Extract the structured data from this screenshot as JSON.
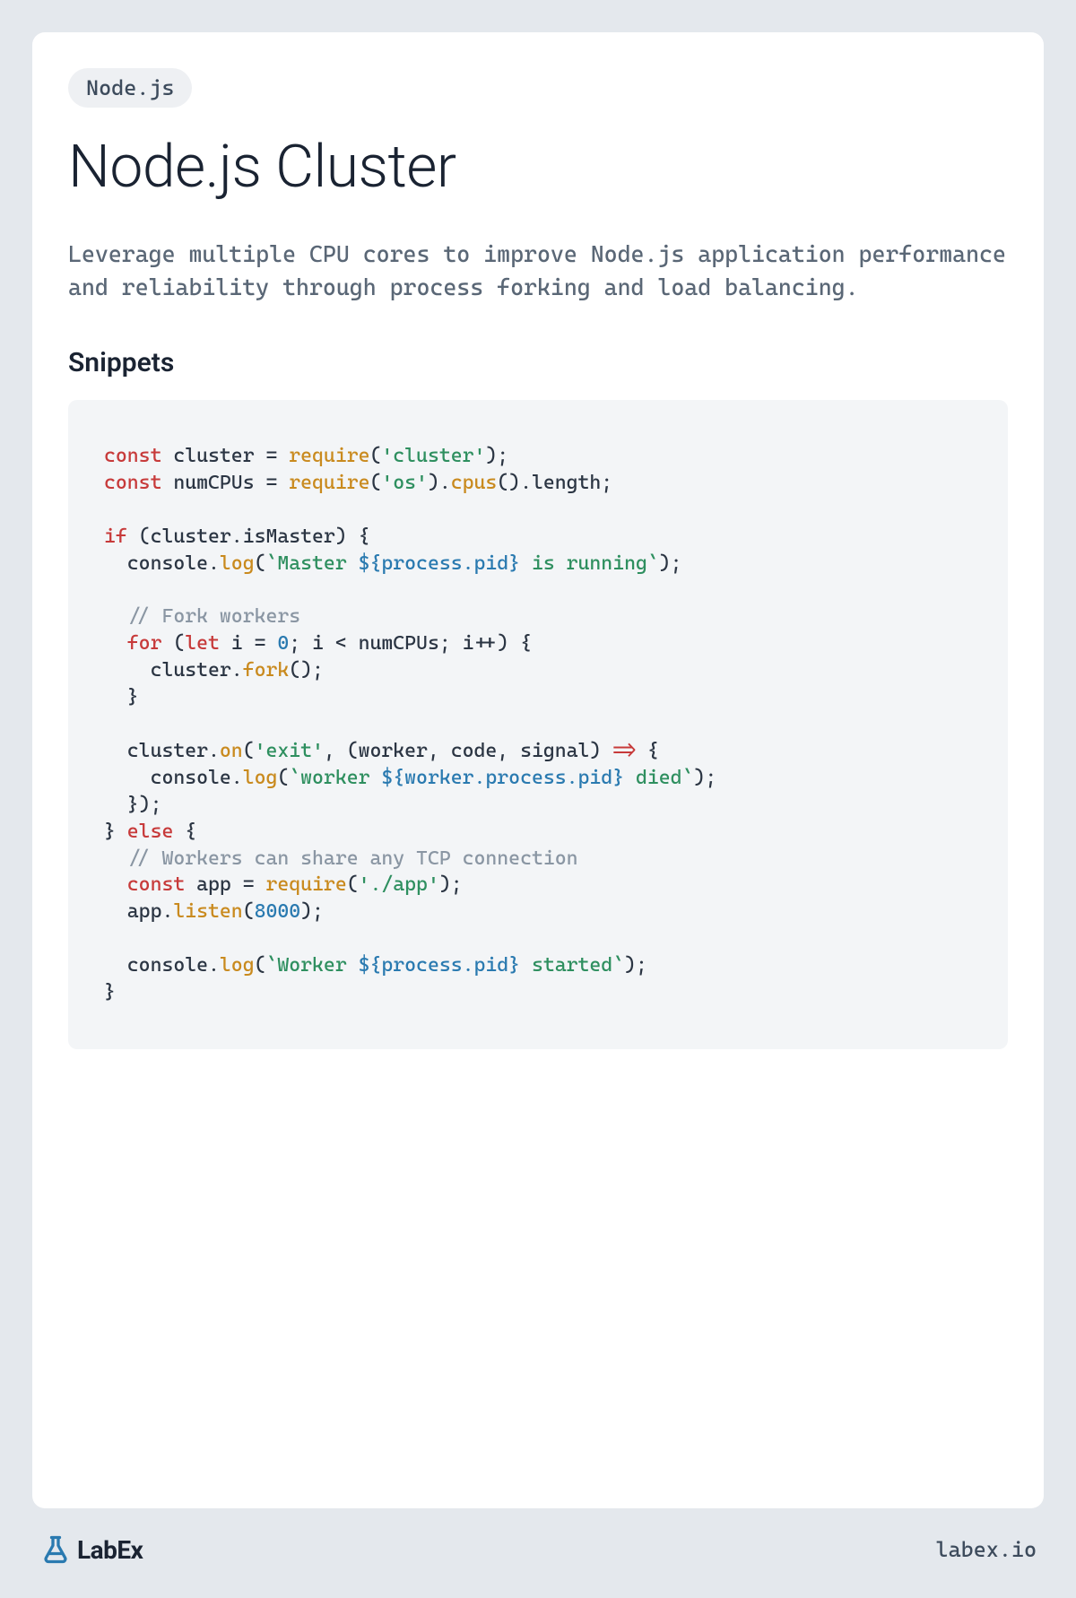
{
  "tag": "Node.js",
  "title": "Node.js Cluster",
  "description": "Leverage multiple CPU cores to improve Node.js application performance and reliability through process forking and load balancing.",
  "section_heading": "Snippets",
  "snippet": {
    "tokens": [
      {
        "t": "const",
        "c": "tok-kw"
      },
      {
        "t": " cluster = "
      },
      {
        "t": "require",
        "c": "tok-fn"
      },
      {
        "t": "("
      },
      {
        "t": "'cluster'",
        "c": "tok-str"
      },
      {
        "t": ");\n"
      },
      {
        "t": "const",
        "c": "tok-kw"
      },
      {
        "t": " numCPUs = "
      },
      {
        "t": "require",
        "c": "tok-fn"
      },
      {
        "t": "("
      },
      {
        "t": "'os'",
        "c": "tok-str"
      },
      {
        "t": ")."
      },
      {
        "t": "cpus",
        "c": "tok-fn"
      },
      {
        "t": "().length;\n"
      },
      {
        "t": "\n"
      },
      {
        "t": "if",
        "c": "tok-kw"
      },
      {
        "t": " (cluster.isMaster) {\n"
      },
      {
        "t": "  console."
      },
      {
        "t": "log",
        "c": "tok-fn"
      },
      {
        "t": "("
      },
      {
        "t": "`Master ",
        "c": "tok-str"
      },
      {
        "t": "${process.pid}",
        "c": "tok-prop"
      },
      {
        "t": " is running`",
        "c": "tok-str"
      },
      {
        "t": ");\n"
      },
      {
        "t": "\n"
      },
      {
        "t": "  // Fork workers\n",
        "c": "tok-com"
      },
      {
        "t": "  "
      },
      {
        "t": "for",
        "c": "tok-kw"
      },
      {
        "t": " ("
      },
      {
        "t": "let",
        "c": "tok-kw"
      },
      {
        "t": " i = "
      },
      {
        "t": "0",
        "c": "tok-num"
      },
      {
        "t": "; i < numCPUs; i++) {\n"
      },
      {
        "t": "    cluster."
      },
      {
        "t": "fork",
        "c": "tok-fn"
      },
      {
        "t": "();\n"
      },
      {
        "t": "  }\n"
      },
      {
        "t": "\n"
      },
      {
        "t": "  cluster."
      },
      {
        "t": "on",
        "c": "tok-fn"
      },
      {
        "t": "("
      },
      {
        "t": "'exit'",
        "c": "tok-str"
      },
      {
        "t": ", (worker, code, signal) "
      },
      {
        "t": "=>",
        "c": "tok-kw"
      },
      {
        "t": " {\n"
      },
      {
        "t": "    console."
      },
      {
        "t": "log",
        "c": "tok-fn"
      },
      {
        "t": "("
      },
      {
        "t": "`worker ",
        "c": "tok-str"
      },
      {
        "t": "${worker.process.pid}",
        "c": "tok-prop"
      },
      {
        "t": " died`",
        "c": "tok-str"
      },
      {
        "t": ");\n"
      },
      {
        "t": "  });\n"
      },
      {
        "t": "} "
      },
      {
        "t": "else",
        "c": "tok-kw"
      },
      {
        "t": " {\n"
      },
      {
        "t": "  // Workers can share any TCP connection\n",
        "c": "tok-com"
      },
      {
        "t": "  "
      },
      {
        "t": "const",
        "c": "tok-kw"
      },
      {
        "t": " app = "
      },
      {
        "t": "require",
        "c": "tok-fn"
      },
      {
        "t": "("
      },
      {
        "t": "'./app'",
        "c": "tok-str"
      },
      {
        "t": ");\n"
      },
      {
        "t": "  app."
      },
      {
        "t": "listen",
        "c": "tok-fn"
      },
      {
        "t": "("
      },
      {
        "t": "8000",
        "c": "tok-num"
      },
      {
        "t": ");\n"
      },
      {
        "t": "\n"
      },
      {
        "t": "  console."
      },
      {
        "t": "log",
        "c": "tok-fn"
      },
      {
        "t": "("
      },
      {
        "t": "`Worker ",
        "c": "tok-str"
      },
      {
        "t": "${process.pid}",
        "c": "tok-prop"
      },
      {
        "t": " started`",
        "c": "tok-str"
      },
      {
        "t": ");\n"
      },
      {
        "t": "}"
      }
    ]
  },
  "brand": {
    "name": "LabEx",
    "url": "labex.io",
    "icon_color": "#2a7ab0"
  }
}
